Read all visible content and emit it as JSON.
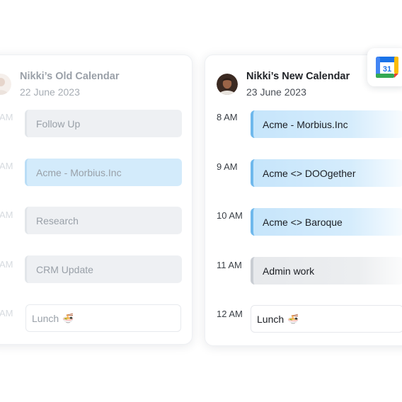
{
  "old_calendar": {
    "title": "Nikki’s Old Calendar",
    "date": "22 June 2023",
    "times": [
      "AM",
      "AM",
      "AM",
      "AM",
      "AM"
    ],
    "events": [
      {
        "label": "Follow Up",
        "style": "gray"
      },
      {
        "label": "Acme - Morbius.Inc",
        "style": "blue"
      },
      {
        "label": "Research",
        "style": "gray"
      },
      {
        "label": "CRM Update",
        "style": "gray"
      },
      {
        "label": "Lunch",
        "style": "white",
        "icon": "🍜"
      }
    ]
  },
  "new_calendar": {
    "title": "Nikki’s New Calendar",
    "date": "23 June 2023",
    "times": [
      "8 AM",
      "9 AM",
      "10 AM",
      "11 AM",
      "12 AM"
    ],
    "events": [
      {
        "label": "Acme - Morbius.Inc",
        "style": "blue"
      },
      {
        "label": "Acme <> DOOgether",
        "style": "blue"
      },
      {
        "label": "Acme <> Baroque",
        "style": "blue"
      },
      {
        "label": "Admin work",
        "style": "gray"
      },
      {
        "label": "Lunch",
        "style": "white",
        "icon": "🍜"
      }
    ]
  },
  "badge": {
    "icon": "google-calendar-icon",
    "day": "31"
  },
  "colors": {
    "event_blue": "#c6e5fb",
    "event_blue_accent": "#6fb8ec",
    "event_gray": "#e7e9ec",
    "event_gray_accent": "#c9cdd3"
  }
}
